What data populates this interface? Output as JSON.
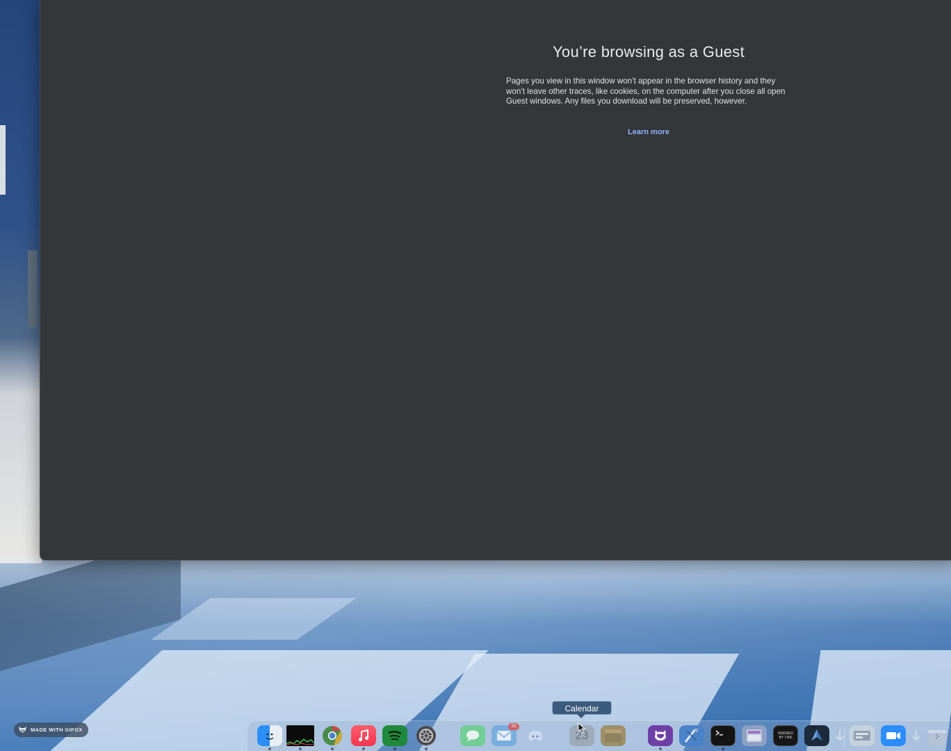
{
  "guest_page": {
    "title": "You’re browsing as a Guest",
    "description": "Pages you view in this window won’t appear in the browser history and they won’t leave other traces, like cookies, on the computer after you close all open Guest windows. Any files you download will be preserved, however.",
    "learn_more": "Learn more",
    "link_color": "#8ab4f8",
    "background_color": "#35363a"
  },
  "watermark": {
    "text": "MADE WITH GIFOX"
  },
  "dock": {
    "tooltip": "Calendar",
    "items": [
      {
        "icon": "finder-icon"
      },
      {
        "icon": "activity-monitor-icon"
      },
      {
        "icon": "chrome-icon"
      },
      {
        "icon": "music-icon"
      },
      {
        "icon": "spotify-icon"
      },
      {
        "icon": "system-preferences-icon"
      },
      {
        "icon": "messages-icon"
      },
      {
        "icon": "mail-icon",
        "badge": "55"
      },
      {
        "icon": "discord-icon"
      },
      {
        "icon": "calendar-icon",
        "label": "23"
      },
      {
        "icon": "notes-icon"
      },
      {
        "icon": "github-desktop-icon"
      },
      {
        "icon": "xcode-icon"
      },
      {
        "icon": "terminal-icon"
      },
      {
        "icon": "simulator-icon"
      },
      {
        "icon": "warp-icon",
        "label": "WARNED BY 7456"
      },
      {
        "icon": "affinity-icon"
      },
      {
        "icon": "downloads-icon"
      },
      {
        "icon": "screenshot-icon"
      },
      {
        "icon": "zoom-icon"
      },
      {
        "icon": "documents-icon"
      },
      {
        "icon": "trash-icon"
      }
    ]
  }
}
